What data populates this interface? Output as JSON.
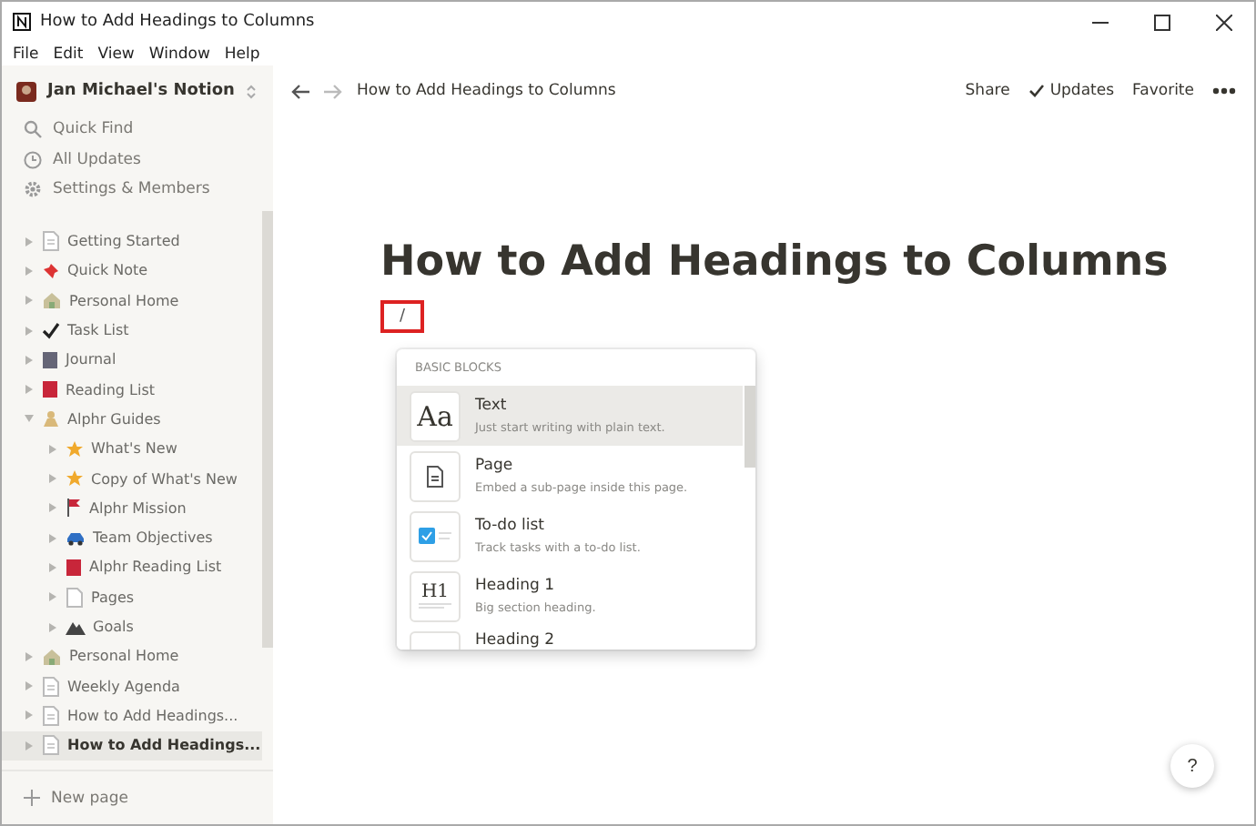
{
  "window": {
    "title": "How to Add Headings to Columns"
  },
  "menu_bar": [
    "File",
    "Edit",
    "View",
    "Window",
    "Help"
  ],
  "sidebar": {
    "workspace": "Jan Michael's Notion",
    "actions": [
      {
        "kind": "search",
        "label": "Quick Find"
      },
      {
        "kind": "clock",
        "label": "All Updates"
      },
      {
        "kind": "gear",
        "label": "Settings & Members"
      }
    ],
    "items": [
      {
        "kind": "doc",
        "label": "Getting Started",
        "selected": false,
        "expanded": false
      },
      {
        "kind": "pin",
        "label": "Quick Note",
        "selected": false,
        "expanded": false
      },
      {
        "kind": "house",
        "label": "Personal Home",
        "selected": false,
        "expanded": false
      },
      {
        "kind": "check",
        "label": "Task List",
        "selected": false,
        "expanded": false
      },
      {
        "kind": "book",
        "label": "Journal",
        "selected": false,
        "expanded": false
      },
      {
        "kind": "redbook",
        "label": "Reading List",
        "selected": false,
        "expanded": false
      },
      {
        "kind": "person",
        "label": "Alphr Guides",
        "selected": false,
        "expanded": true,
        "children": [
          {
            "kind": "star",
            "label": "What's New",
            "selected": false,
            "expanded": false
          },
          {
            "kind": "star",
            "label": "Copy of What's New",
            "selected": false,
            "expanded": false
          },
          {
            "kind": "flag",
            "label": "Alphr Mission",
            "selected": false,
            "expanded": false
          },
          {
            "kind": "car",
            "label": "Team Objectives",
            "selected": false,
            "expanded": false
          },
          {
            "kind": "redbook",
            "label": "Alphr Reading List",
            "selected": false,
            "expanded": false
          },
          {
            "kind": "blank",
            "label": "Pages",
            "selected": false,
            "expanded": false
          },
          {
            "kind": "mountain",
            "label": "Goals",
            "selected": false,
            "expanded": false
          }
        ]
      },
      {
        "kind": "house",
        "label": "Personal Home",
        "selected": false,
        "expanded": false
      },
      {
        "kind": "doc",
        "label": "Weekly Agenda",
        "selected": false,
        "expanded": false
      },
      {
        "kind": "doc",
        "label": "How to Add Headings...",
        "selected": false,
        "expanded": false
      },
      {
        "kind": "doc",
        "label": "How to Add Headings...",
        "selected": true,
        "expanded": false
      }
    ],
    "new_page": "New page"
  },
  "topbar": {
    "breadcrumb": "How to Add Headings to Columns",
    "actions": [
      "Share",
      "Updates",
      "Favorite"
    ]
  },
  "page": {
    "title": "How to Add Headings to Columns",
    "typed": "/"
  },
  "block_menu": {
    "section": "BASIC BLOCKS",
    "items": [
      {
        "kind": "text",
        "thumb": "Aa",
        "label": "Text",
        "description": "Just start writing with plain text.",
        "selected": true
      },
      {
        "kind": "page",
        "label": "Page",
        "description": "Embed a sub-page inside this page.",
        "selected": false
      },
      {
        "kind": "todo",
        "label": "To-do list",
        "description": "Track tasks with a to-do list.",
        "selected": false
      },
      {
        "kind": "heading",
        "thumb": "H1",
        "label": "Heading 1",
        "description": "Big section heading.",
        "selected": false
      },
      {
        "kind": "heading",
        "label": "Heading 2",
        "selected": false
      }
    ]
  },
  "help": "?"
}
